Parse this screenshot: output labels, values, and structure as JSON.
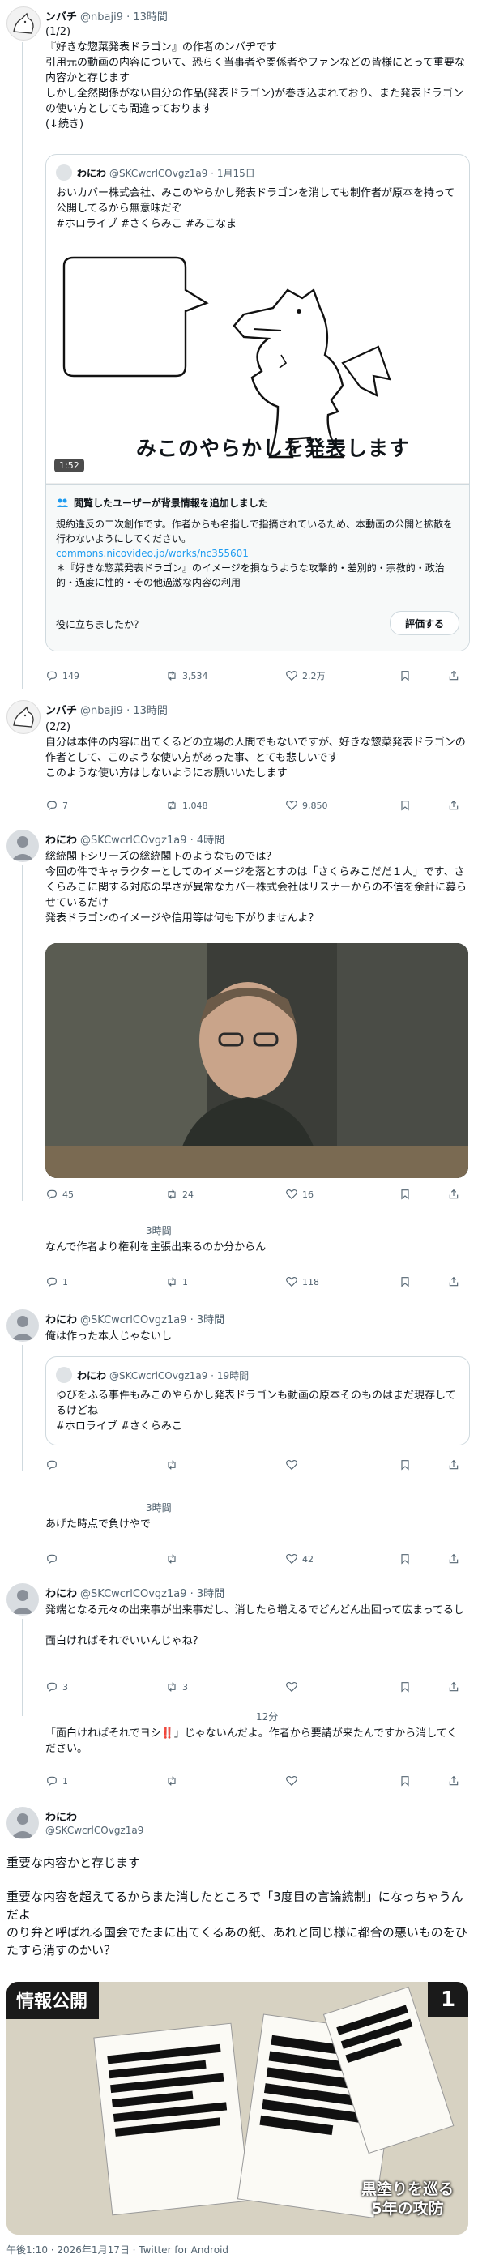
{
  "tweet1": {
    "name": "ンバチ",
    "handle_time": "@nbaji9 · 13時間",
    "text": "(1/2)\n『好きな惣菜発表ドラゴン』の作者のンバヂです\n引用元の動画の内容について、恐らく当事者や関係者やファンなどの皆様にとって重要な内容かと存じます\nしかし全然関係がない自分の作品(発表ドラゴン)が巻き込まれており、また発表ドラゴンの使い方としても間違っております\n(↓続き)",
    "quote": {
      "name": "わにわ",
      "handle_time": "@SKCwcrlCOvgz1a9 · 1月15日",
      "text": "おいカバー株式会社、みこのやらかし発表ドラゴンを消しても制作者が原本を持って公開してるから無意味だぞ\n#ホロライブ #さくらみこ #みこなま",
      "video_caption": "みこのやらかしを発表します",
      "video_duration": "1:52",
      "note_heading": "閲覧したユーザーが背景情報を追加しました",
      "note_body": "規約違反の二次創作です。作者からも名指しで指摘されているため、本動画の公開と拡散を行わないようにしてください。",
      "note_link": "commons.nicovideo.jp/works/nc355601",
      "note_body2": "＊『好きな惣菜発表ドラゴン』のイメージを損なうような攻撃的・差別的・宗教的・政治的・過度に性的・その他過激な内容の利用",
      "note_helpful": "役に立ちましたか？",
      "note_rate": "評価する"
    },
    "actions": {
      "reply": "149",
      "retweet": "3,534",
      "like": "2.2万"
    }
  },
  "tweet2": {
    "name": "ンバチ",
    "handle_time": "@nbaji9 · 13時間",
    "text": "(2/2)\n自分は本件の内容に出てくるどの立場の人間でもないですが、好きな惣菜発表ドラゴンの作者として、このような使い方があった事、とても悲しいです\nこのような使い方はしないようにお願いいたします",
    "actions": {
      "reply": "7",
      "retweet": "1,048",
      "like": "9,850"
    }
  },
  "tweet3": {
    "name": "わにわ",
    "handle_time": "@SKCwcrlCOvgz1a9 · 4時間",
    "text": "総統閣下シリーズの総統閣下のようなものでは？\n今回の件でキャラクターとしてのイメージを落とすのは「さくらみこだだ１人」です、さくらみこに関する対応の早さが異常なカバー株式会社はリスナーからの不信を余計に募らせているだけ\n発表ドラゴンのイメージや信用等は何も下がりませんよ？",
    "actions": {
      "reply": "45",
      "retweet": "24",
      "like": "16"
    }
  },
  "tweet4": {
    "time": "3時間",
    "text": "なんで作者より権利を主張出来るのか分からん",
    "actions": {
      "reply": "1",
      "retweet": "1",
      "like": "118"
    }
  },
  "tweet5": {
    "name": "わにわ",
    "handle_time": "@SKCwcrlCOvgz1a9 · 3時間",
    "text": "俺は作った本人じゃないし",
    "quote": {
      "name": "わにわ",
      "handle_time": "@SKCwcrlCOvgz1a9 · 19時間",
      "text": "ゆびをふる事件もみこのやらかし発表ドラゴンも動画の原本そのものはまだ現存してるけどね\n#ホロライブ #さくらみこ"
    },
    "actions": {
      "reply": "",
      "retweet": "",
      "like": ""
    }
  },
  "tweet6": {
    "time": "3時間",
    "text": "あげた時点で負けやで",
    "actions": {
      "reply": "",
      "retweet": "",
      "like": "42"
    }
  },
  "tweet7": {
    "name": "わにわ",
    "handle_time": "@SKCwcrlCOvgz1a9 · 3時間",
    "text": "発端となる元々の出来事が出来事だし、消したら増えるでどんどん出回って広まってるし\n\n面白ければそれでいいんじゃね？",
    "actions": {
      "reply": "3",
      "retweet": "3",
      "like": ""
    }
  },
  "tweet8": {
    "time": "12分",
    "text": "「面白ければそれでヨシ‼️」じゃないんだよ。作者から要請が来たんですから消してください。",
    "actions": {
      "reply": "1",
      "retweet": "",
      "like": ""
    }
  },
  "tweet9": {
    "name": "わにわ",
    "handle": "@SKCwcrlCOvgz1a9",
    "text1": "重要な内容かと存じます",
    "text2": "重要な内容を超えてるからまた消したところで「3度目の言論統制」になっちゃうんだよ\nのり弁と呼ばれる国会でたまに出てくるあの紙、あれと同じ様に都合の悪いものをひたすら消すのかい？",
    "image": {
      "badge": "情報公開",
      "number": "1",
      "caption1": "黒塗りを巡る",
      "caption2": "5年の攻防"
    },
    "footer": "午後1:10 · 2026年1月17日 · Twitter for Android"
  }
}
